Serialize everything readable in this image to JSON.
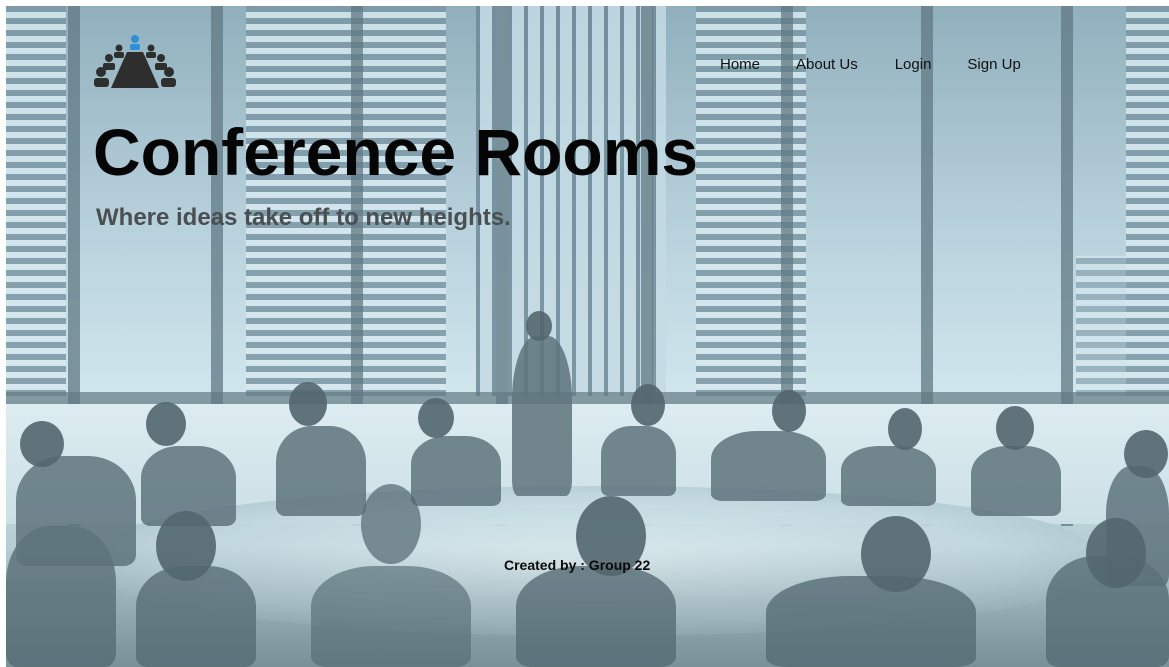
{
  "header": {
    "logo_icon": "conference-table-icon",
    "nav": {
      "home": "Home",
      "about": "About Us",
      "login": "Login",
      "signup": "Sign Up"
    }
  },
  "hero": {
    "title": "Conference Rooms",
    "subtitle": "Where ideas take off to new heights.",
    "background_image": "meeting-room-photo"
  },
  "footer": {
    "credit": "Created by : Group 22"
  },
  "colors": {
    "title": "#050505",
    "subtitle": "#4a4f52",
    "nav_text": "#111111",
    "logo_dark": "#2e2e2e",
    "logo_accent": "#2f8fd6"
  }
}
